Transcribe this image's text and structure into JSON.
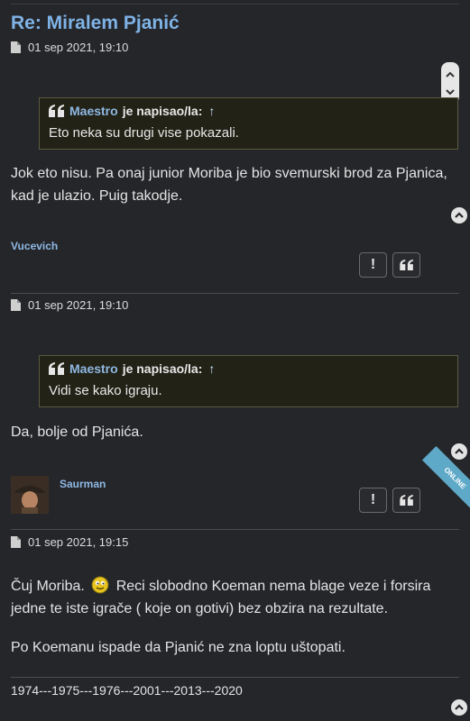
{
  "thread_title": "Re: Miralem Pjanić",
  "posts": [
    {
      "datetime": "01 sep 2021, 19:10",
      "quote": {
        "author": "Maestro",
        "wrote": "je napisao/la:",
        "arrow": "↑",
        "text": "Eto neka su drugi vise pokazali."
      },
      "body": "Jok eto nisu. Pa onaj junior Moriba je bio svemurski brod za Pjanica, kad je ulazio. Puig takodje."
    },
    {
      "username": "Vucevich",
      "report_label": "!",
      "quote_label": "❝",
      "datetime": "01 sep 2021, 19:10",
      "quote": {
        "author": "Maestro",
        "wrote": "je napisao/la:",
        "arrow": "↑",
        "text": "Vidi se kako igraju."
      },
      "body": "Da, bolje od Pjanića."
    },
    {
      "username": "Saurman",
      "online_label": "ONLINE",
      "report_label": "!",
      "quote_label": "❝",
      "datetime": "01 sep 2021, 19:15",
      "body_part1": "Čuj Moriba.",
      "body_part2": "Reci slobodno Koeman nema blage veze i forsira jedne te iste igrače ( koje on gotivi) bez obzira na rezultate.",
      "body_para2": "Po Koemanu ispade da Pjanić ne zna loptu uštopati.",
      "signature": "1974---1975---1976---2001---2013---2020"
    }
  ]
}
